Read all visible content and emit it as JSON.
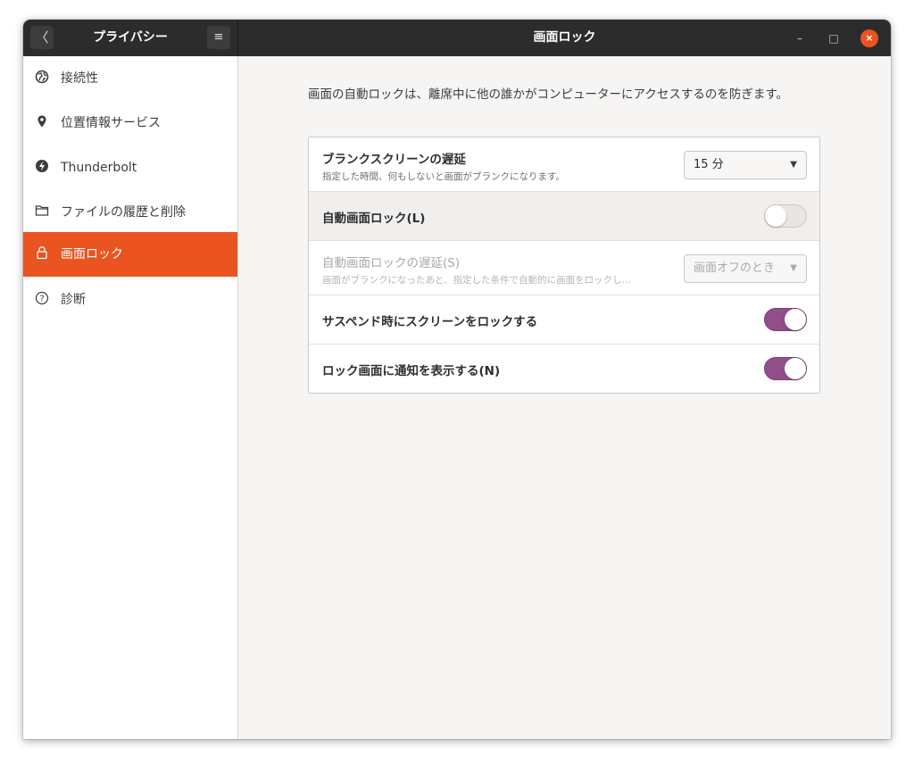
{
  "header": {
    "back_icon": "〈",
    "sidebar_title": "プライバシー",
    "menu_icon": "≡",
    "main_title": "画面ロック",
    "minimize_icon": "–",
    "maximize_icon": "□",
    "close_icon": "×",
    "close_color": "#e95420"
  },
  "sidebar": {
    "items": [
      {
        "label": "接続性",
        "icon": "globe-icon",
        "glyph": "🌐"
      },
      {
        "label": "位置情報サービス",
        "icon": "location-pin-icon",
        "glyph": "♦"
      },
      {
        "label": "Thunderbolt",
        "icon": "thunderbolt-icon",
        "glyph": "ϟ"
      },
      {
        "label": "ファイルの履歴と削除",
        "icon": "folder-icon",
        "glyph": "🗀"
      },
      {
        "label": "画面ロック",
        "icon": "lock-icon",
        "glyph": "🔒",
        "active": true
      },
      {
        "label": "診断",
        "icon": "help-icon",
        "glyph": "?"
      }
    ],
    "active_color": "#e95420"
  },
  "main": {
    "description": "画面の自動ロックは、離席中に他の誰かがコンピューターにアクセスするのを防ぎます。",
    "rows": [
      {
        "title": "ブランクスクリーンの遅延",
        "subtitle": "指定した時間、何もしないと画面がブランクになります。",
        "control": "dropdown",
        "value": "15 分"
      },
      {
        "title": "自動画面ロック(L)",
        "control": "toggle",
        "state": false
      },
      {
        "title": "自動画面ロックの遅延(S)",
        "subtitle": "画面がブランクになったあと、指定した条件で自動的に画面をロックし...",
        "control": "dropdown",
        "value": "画面オフのとき",
        "disabled": true
      },
      {
        "title": "サスペンド時にスクリーンをロックする",
        "control": "toggle",
        "state": true
      },
      {
        "title": "ロック画面に通知を表示する(N)",
        "control": "toggle",
        "state": true
      }
    ],
    "toggle_on_color": "#924d8b",
    "dropdown_arrow": "▼"
  }
}
